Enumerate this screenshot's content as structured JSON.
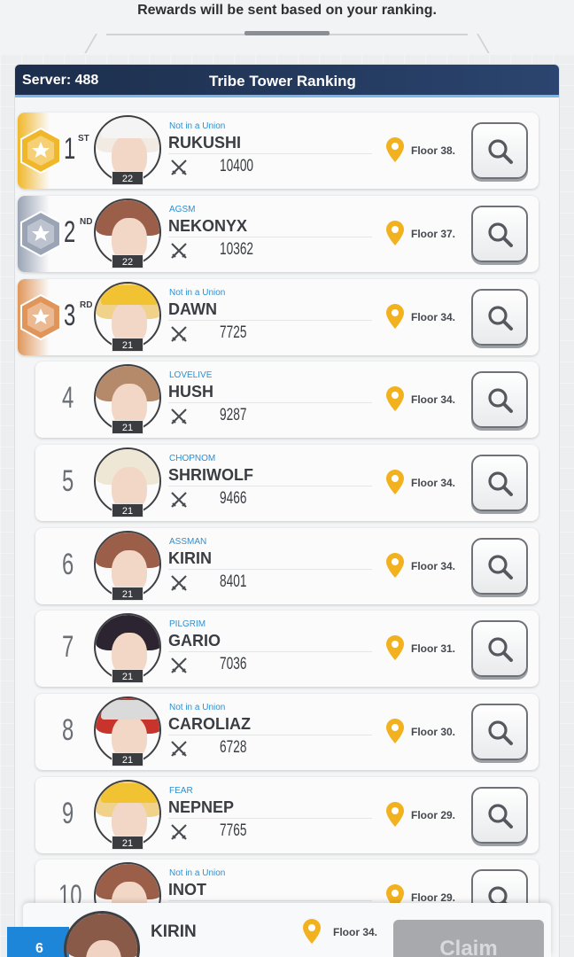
{
  "notice": "Rewards will be sent based on your ranking.",
  "header": {
    "server": "Server: 488",
    "title": "Tribe Tower Ranking"
  },
  "colors": {
    "gold": "#f0b72a",
    "silver": "#9aa4b4",
    "bronze": "#e0965a",
    "union_text": "#2f8fcf",
    "pin": "#f2b21f",
    "header_bg": "#1c2e4c",
    "my_rank_bg": "#1d86d8"
  },
  "rows": [
    {
      "rank": "1",
      "suffix": "ST",
      "union": "Not in a Union",
      "name": "RUKUSHI",
      "power": "10400",
      "level": "22",
      "floor": "Floor 38."
    },
    {
      "rank": "2",
      "suffix": "ND",
      "union": "AGSM",
      "name": "NEKONYX",
      "power": "10362",
      "level": "22",
      "floor": "Floor 37."
    },
    {
      "rank": "3",
      "suffix": "RD",
      "union": "Not in a Union",
      "name": "DAWN",
      "power": "7725",
      "level": "21",
      "floor": "Floor 34."
    },
    {
      "rank": "4",
      "suffix": "",
      "union": "LOVELIVE",
      "name": "HUSH",
      "power": "9287",
      "level": "21",
      "floor": "Floor 34."
    },
    {
      "rank": "5",
      "suffix": "",
      "union": "CHOPNOM",
      "name": "SHRIWOLF",
      "power": "9466",
      "level": "21",
      "floor": "Floor 34."
    },
    {
      "rank": "6",
      "suffix": "",
      "union": "ASSMAN",
      "name": "KIRIN",
      "power": "8401",
      "level": "21",
      "floor": "Floor 34."
    },
    {
      "rank": "7",
      "suffix": "",
      "union": "PILGRIM",
      "name": "GARIO",
      "power": "7036",
      "level": "21",
      "floor": "Floor 31."
    },
    {
      "rank": "8",
      "suffix": "",
      "union": "Not in a Union",
      "name": "CAROLIAZ",
      "power": "6728",
      "level": "21",
      "floor": "Floor 30."
    },
    {
      "rank": "9",
      "suffix": "",
      "union": "FEAR",
      "name": "NEPNEP",
      "power": "7765",
      "level": "21",
      "floor": "Floor 29."
    },
    {
      "rank": "10",
      "suffix": "",
      "union": "Not in a Union",
      "name": "INOT",
      "power": "",
      "level": "",
      "floor": "Floor 29."
    }
  ],
  "my_entry": {
    "rank": "6",
    "name": "KIRIN",
    "floor": "Floor 34.",
    "claim_label": "Claim"
  },
  "icons": {
    "search": "magnifier-icon",
    "location": "map-pin-icon",
    "power": "crossed-swords-icon",
    "medal": "hexagon-star-medal-icon"
  }
}
